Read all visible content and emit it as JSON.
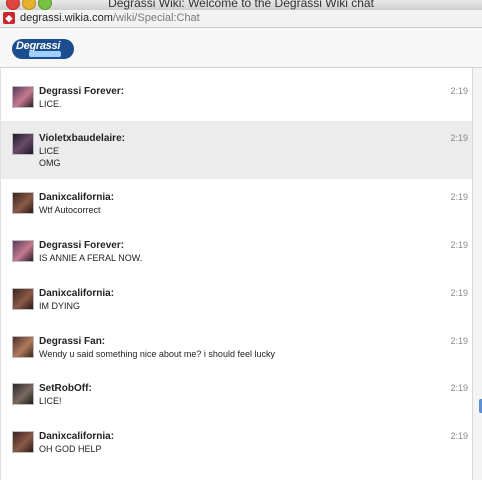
{
  "window": {
    "title": "Degrassi Wiki: Welcome to the Degrassi Wiki chat"
  },
  "address_bar": {
    "url_domain": "degrassi.wikia.com",
    "url_path": "/wiki/Special:Chat"
  },
  "header": {
    "logo_text": "Degrassi",
    "logo_icon": "degrassi-wiki-logo"
  },
  "messages": [
    {
      "author": "Degrassi Forever:",
      "lines": [
        "LICE."
      ],
      "time": "2:19"
    },
    {
      "author": "Violetxbaudelaire:",
      "lines": [
        "LICE",
        "OMG"
      ],
      "time": "2:19"
    },
    {
      "author": "Danixcalifornia:",
      "lines": [
        "Wtf Autocorrect"
      ],
      "time": "2:19"
    },
    {
      "author": "Degrassi Forever:",
      "lines": [
        "IS ANNIE A FERAL NOW."
      ],
      "time": "2:19"
    },
    {
      "author": "Danixcalifornia:",
      "lines": [
        "IM DYING"
      ],
      "time": "2:19"
    },
    {
      "author": "Degrassi Fan:",
      "lines": [
        "Wendy u said something nice about me? i should feel lucky"
      ],
      "time": "2:19"
    },
    {
      "author": "SetRobOff:",
      "lines": [
        "LICE!"
      ],
      "time": "2:19"
    },
    {
      "author": "Danixcalifornia:",
      "lines": [
        "OH GOD HELP"
      ],
      "time": "2:19"
    }
  ],
  "colors": {
    "highlight_row": "#ececec",
    "text": "#222222",
    "timestamp": "#888888"
  }
}
